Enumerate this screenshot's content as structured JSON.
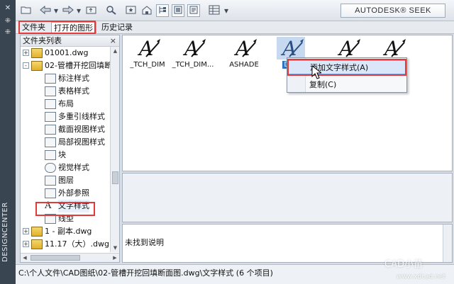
{
  "side_strip": {
    "title": "DESIGNCENTER",
    "close_glyph": "✕",
    "settings_glyph": "⁜",
    "settings2_glyph": "⁜"
  },
  "toolbar": {
    "icons": [
      "open-folder-icon",
      "back-icon",
      "forward-icon",
      "folder-up-icon",
      "search-icon",
      "favorites-icon",
      "home-icon",
      "tree-toggle-icon",
      "preview-toggle-icon",
      "description-toggle-icon",
      "views-icon"
    ],
    "seek_label": "AUTODESK® SEEK"
  },
  "tabs": [
    {
      "label": "文件夹",
      "active": false
    },
    {
      "label": "打开的图形",
      "active": true
    },
    {
      "label": "历史记录",
      "active": false
    }
  ],
  "tree": {
    "header": "文件夹列表",
    "close_glyph": "×",
    "rows": [
      {
        "label": "01001.dwg",
        "icon": "dwg-file-icon",
        "expander": "+",
        "indent": 0
      },
      {
        "label": "02-管槽开挖回填断",
        "icon": "dwg-file-icon",
        "expander": "-",
        "indent": 0
      },
      {
        "label": "标注样式",
        "icon": "dimstyle-icon",
        "indent": 1
      },
      {
        "label": "表格样式",
        "icon": "tablestyle-icon",
        "indent": 1
      },
      {
        "label": "布局",
        "icon": "layout-icon",
        "indent": 1
      },
      {
        "label": "多重引线样式",
        "icon": "mleaderstyle-icon",
        "indent": 1
      },
      {
        "label": "截面视图样式",
        "icon": "sectionview-icon",
        "indent": 1
      },
      {
        "label": "局部视图样式",
        "icon": "detailview-icon",
        "indent": 1
      },
      {
        "label": "块",
        "icon": "block-icon",
        "indent": 1
      },
      {
        "label": "视觉样式",
        "icon": "visualstyle-icon",
        "indent": 1
      },
      {
        "label": "图层",
        "icon": "layer-icon",
        "indent": 1
      },
      {
        "label": "外部参照",
        "icon": "xref-icon",
        "indent": 1
      },
      {
        "label": "文字样式",
        "icon": "textstyle-icon",
        "indent": 1,
        "selected": true
      },
      {
        "label": "线型",
        "icon": "linetype-icon",
        "indent": 1
      },
      {
        "label": "1 - 副本.dwg",
        "icon": "dwg-file-icon",
        "expander": "+",
        "indent": 0
      },
      {
        "label": "11.17（大）.dwg",
        "icon": "dwg-file-icon",
        "expander": "+",
        "indent": 0
      }
    ]
  },
  "preview": {
    "items": [
      {
        "label": "_TCH_DIM",
        "selected": false
      },
      {
        "label": "_TCH_DIM...",
        "selected": false
      },
      {
        "label": "ASHADE",
        "selected": false
      },
      {
        "label": "DIM",
        "selected": true
      },
      {
        "label": "",
        "selected": false
      },
      {
        "label": "",
        "selected": false
      }
    ]
  },
  "context_menu": {
    "items": [
      {
        "label": "添加文字样式(A)",
        "hover": true
      },
      {
        "label": "复制(C)",
        "hover": false
      }
    ]
  },
  "description": {
    "text": "未找到说明"
  },
  "status_bar": {
    "path": "C:\\个人文件\\CAD图纸\\02-管槽开挖回填断面图.dwg\\文字样式 (6 个项目)"
  },
  "watermark": {
    "text": "CAD小苗",
    "url": "www.xdcad.net"
  },
  "colors": {
    "highlight_red": "#e23a3a",
    "selection_blue": "#3072c3",
    "sidebar_dark": "#3a4552"
  }
}
